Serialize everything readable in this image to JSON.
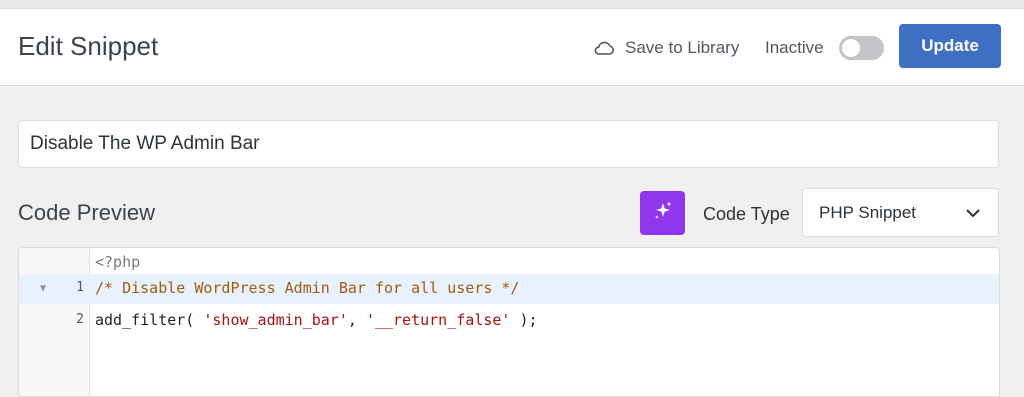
{
  "header": {
    "title": "Edit Snippet",
    "save_to_library": "Save to Library",
    "status_label": "Inactive",
    "update_label": "Update"
  },
  "snippet": {
    "name": "Disable The WP Admin Bar"
  },
  "code_preview": {
    "title": "Code Preview",
    "code_type_label": "Code Type",
    "code_type_value": "PHP Snippet"
  },
  "editor": {
    "lines": [
      {
        "number": "",
        "text": "<?php"
      },
      {
        "number": "1",
        "text": "/* Disable WordPress Admin Bar for all users */"
      },
      {
        "number": "2",
        "text": "add_filter( 'show_admin_bar', '__return_false' );"
      }
    ],
    "tokens": {
      "fn_call": "add_filter(",
      "arg1": "'show_admin_bar'",
      "comma": ", ",
      "arg2": "'__return_false'",
      "close": " );"
    }
  },
  "colors": {
    "accent": "#3f6fc3",
    "ai_button": "#8f36ee",
    "toggle_off": "#c3c4c7",
    "active_line": "#e8f2ff"
  },
  "icons": {
    "save_to_library": "cloud-icon",
    "ai": "sparkles-icon",
    "dropdown": "chevron-down-icon",
    "fold": "fold-arrow-icon"
  }
}
